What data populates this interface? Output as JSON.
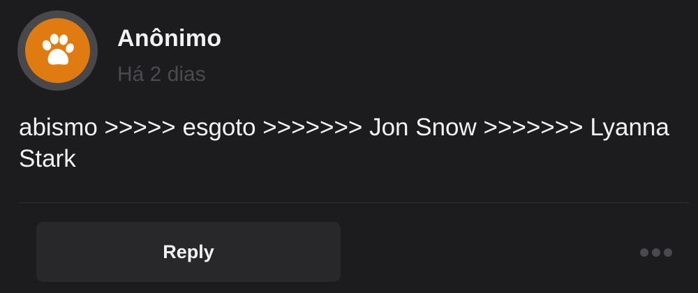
{
  "post": {
    "author": "Anônimo",
    "timestamp": "Há 2 dias",
    "body": "abismo >>>>> esgoto >>>>>>> Jon Snow >>>>>>> Lyanna Stark"
  },
  "avatar": {
    "icon": "paw-icon",
    "background_color": "#e07b12",
    "ring_color": "#48484a"
  },
  "actions": {
    "reply_label": "Reply",
    "more_icon": "more-horizontal-icon"
  }
}
